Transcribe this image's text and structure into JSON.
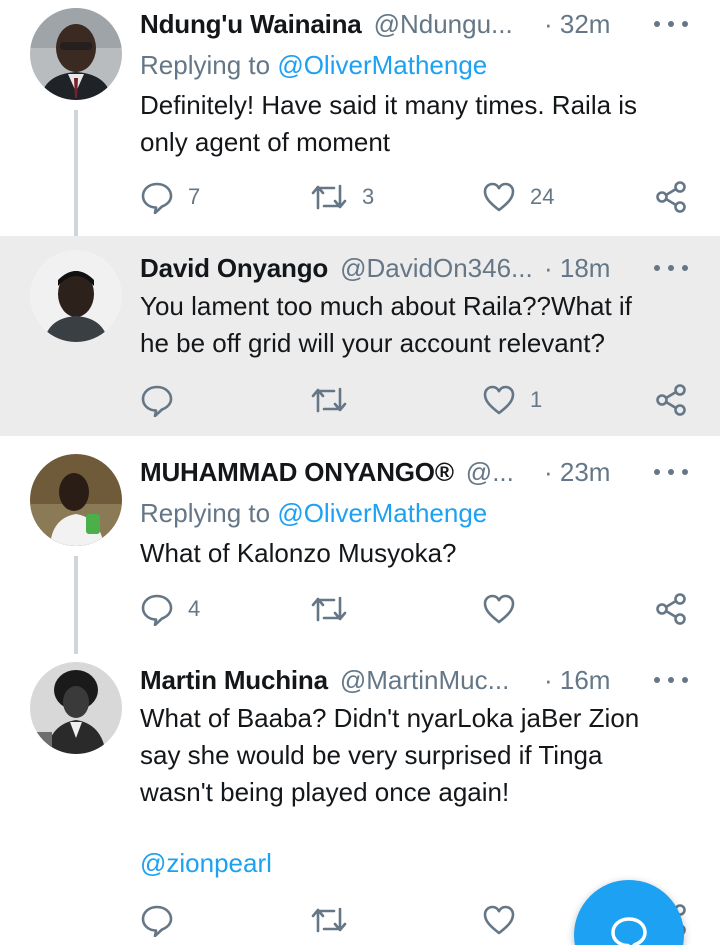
{
  "colors": {
    "accent": "#1da1f2",
    "muted": "#657786",
    "text": "#14171a",
    "highlight_bg": "#ececec"
  },
  "tweets": [
    {
      "name": "Ndung'u Wainaina",
      "handle": "@Ndungu...",
      "time": "· 32m",
      "reply_prefix": "Replying to",
      "reply_to": "@OliverMathenge",
      "text_lines": [
        "Definitely! Have said it many times. Raila is",
        "only agent of moment"
      ],
      "reply_count": "7",
      "retweet_count": "3",
      "like_count": "24"
    },
    {
      "name": "David Onyango",
      "handle": "@DavidOn346...",
      "time": "· 18m",
      "text_lines": [
        "You lament too much about Raila??What if",
        "he be off grid will your account relevant?"
      ],
      "like_count": "1"
    },
    {
      "name": "MUHAMMAD ONYANGO®",
      "handle": "@...",
      "time": "· 23m",
      "reply_prefix": "Replying to",
      "reply_to": "@OliverMathenge",
      "text_lines": [
        "What of Kalonzo Musyoka?"
      ],
      "reply_count": "4"
    },
    {
      "name": "Martin Muchina",
      "handle": "@MartinMuc...",
      "time": "· 16m",
      "text_lines": [
        "What of Baaba? Didn't nyarLoka jaBer Zion",
        "say she would be very surprised if Tinga",
        "wasn't being played once again!"
      ],
      "link": "@zionpearl"
    }
  ],
  "icons": {
    "reply": "reply-icon",
    "retweet": "retweet-icon",
    "like": "heart-icon",
    "share": "share-icon",
    "more": "more-options-icon",
    "compose": "compose-fab-icon"
  }
}
